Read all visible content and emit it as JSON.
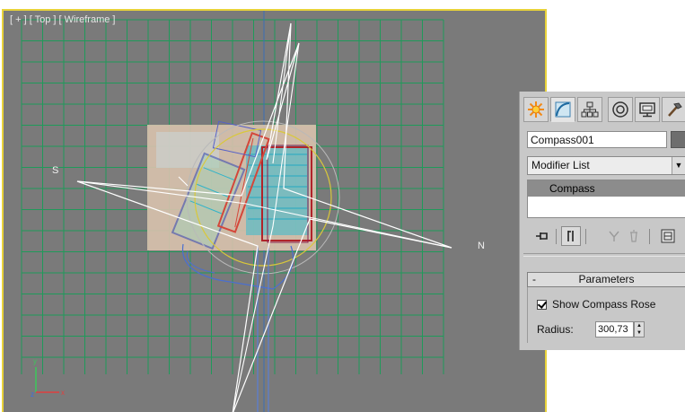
{
  "viewport": {
    "label": "[ + ] [ Top ] [ Wireframe ]",
    "compass": {
      "south_label": "S",
      "north_label": "N"
    },
    "colors": {
      "background": "#7a7a7a",
      "grid": "#1f9a5a",
      "active_border": "#e8d23a",
      "rose": "#ffffff"
    }
  },
  "command_panel": {
    "tabs": [
      {
        "name": "create",
        "icon": "sun-icon"
      },
      {
        "name": "modify",
        "icon": "modify-curve-icon"
      },
      {
        "name": "hierarchy",
        "icon": "hierarchy-icon"
      },
      {
        "name": "motion",
        "icon": "motion-circle-icon"
      },
      {
        "name": "display",
        "icon": "monitor-icon"
      },
      {
        "name": "utilities",
        "icon": "hammer-icon"
      }
    ],
    "object_name": "Compass001",
    "modifier_list": {
      "value": "Modifier List"
    },
    "stack": {
      "items": [
        "Compass"
      ]
    },
    "stack_tools": [
      "pin-stack-icon",
      "show-end-result-icon",
      "make-unique-icon",
      "remove-modifier-icon",
      "configure-modifier-sets-icon"
    ],
    "parameters": {
      "title": "Parameters",
      "collapse_symbol": "-",
      "show_compass_rose": {
        "label": "Show Compass Rose",
        "checked": true
      },
      "radius": {
        "label": "Radius:",
        "value": "300,73"
      }
    }
  }
}
